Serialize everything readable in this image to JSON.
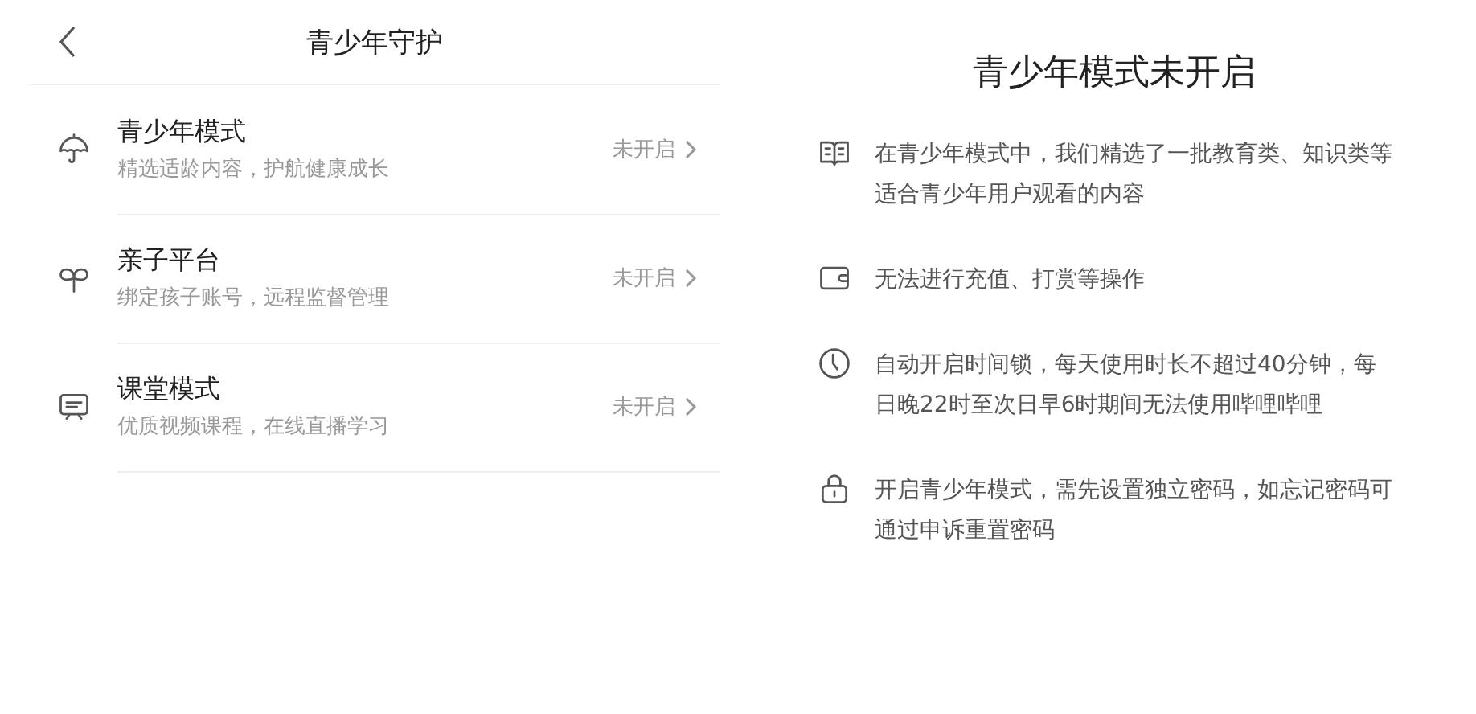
{
  "header": {
    "title": "青少年守护"
  },
  "items": [
    {
      "title": "青少年模式",
      "subtitle": "精选适龄内容，护航健康成长",
      "status": "未开启"
    },
    {
      "title": "亲子平台",
      "subtitle": "绑定孩子账号，远程监督管理",
      "status": "未开启"
    },
    {
      "title": "课堂模式",
      "subtitle": "优质视频课程，在线直播学习",
      "status": "未开启"
    }
  ],
  "info": {
    "title": "青少年模式未开启",
    "points": [
      {
        "lines": [
          "在青少年模式中，我们精选了一批教育类、知识类等",
          "适合青少年用户观看的内容"
        ]
      },
      {
        "lines": [
          "无法进行充值、打赏等操作"
        ]
      },
      {
        "lines": [
          "自动开启时间锁，每天使用时长不超过40分钟，每",
          "日晚22时至次日早6时期间无法使用哔哩哔哩"
        ]
      },
      {
        "lines": [
          "开启青少年模式，需先设置独立密码，如忘记密码可",
          "通过申诉重置密码"
        ]
      }
    ]
  }
}
